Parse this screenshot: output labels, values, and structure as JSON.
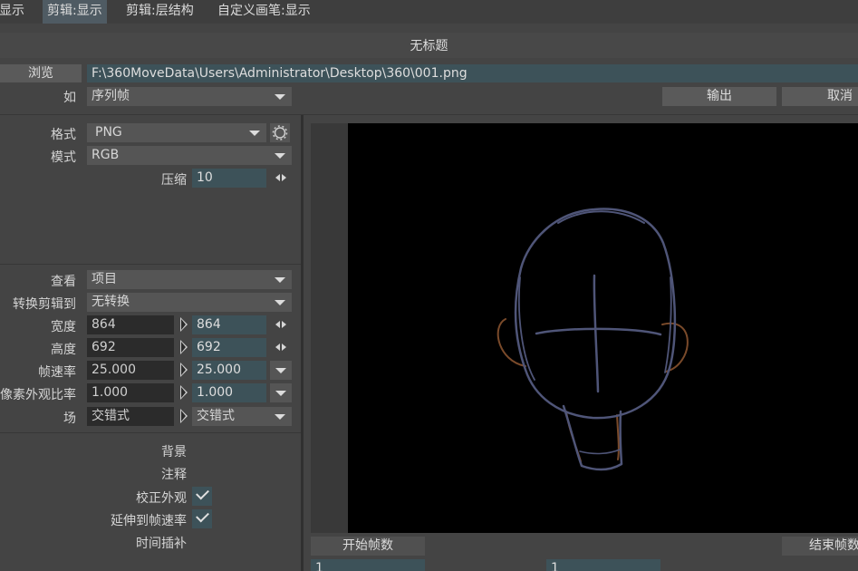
{
  "tabs": [
    {
      "label": "显示",
      "active": false
    },
    {
      "label": "剪辑:显示",
      "active": true
    },
    {
      "label": "剪辑:层结构",
      "active": false
    },
    {
      "label": "自定义画笔:显示",
      "active": false
    }
  ],
  "dialog": {
    "title": "无标题",
    "browse_label": "浏览",
    "path_value": "F:\\360MoveData\\Users\\Administrator\\Desktop\\360\\001.png",
    "as_label": "如",
    "as_value": "序列帧",
    "output_label": "输出",
    "cancel_label": "取消"
  },
  "settings": {
    "format_label": "格式",
    "format_value": "PNG",
    "mode_label": "模式",
    "mode_value": "RGB",
    "compress_label": "压缩",
    "compress_value": "10",
    "view_label": "查看",
    "view_value": "项目",
    "convert_label": "转换剪辑到",
    "convert_value": "无转换",
    "width_label": "宽度",
    "width_src": "864",
    "width_dst": "864",
    "height_label": "高度",
    "height_src": "692",
    "height_dst": "692",
    "fps_label": "帧速率",
    "fps_src": "25.000",
    "fps_dst": "25.000",
    "par_label": "像素外观比率",
    "par_src": "1.000",
    "par_dst": "1.000",
    "field_label": "场",
    "field_src": "交错式",
    "field_dst": "交错式"
  },
  "options": {
    "background_label": "背景",
    "annotation_label": "注释",
    "correct_aspect_label": "校正外观",
    "correct_aspect_checked": true,
    "stretch_fps_label": "延伸到帧速率",
    "stretch_fps_checked": true,
    "interp_label": "时间插补"
  },
  "frames": {
    "start_label": "开始帧数",
    "end_label": "结束帧数",
    "start_value": "1",
    "end_value": "1"
  },
  "colors": {
    "accent_teal": "#3d5259",
    "sketch_head": "#4f5578",
    "sketch_ears": "#7a4a2a"
  }
}
